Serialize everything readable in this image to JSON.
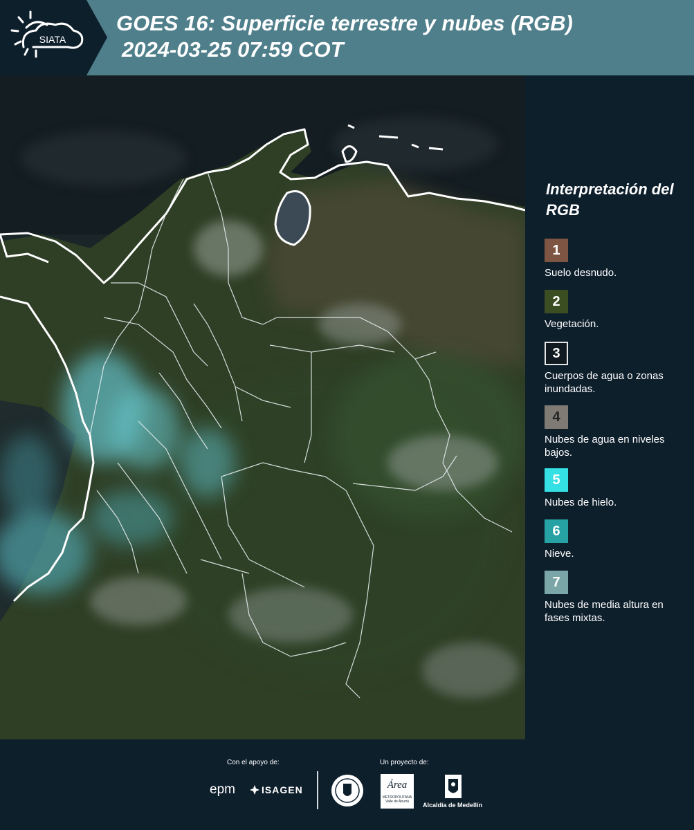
{
  "header": {
    "logo_text": "SIATA",
    "title_line1": "GOES 16: Superficie terrestre y nubes (RGB)",
    "title_line2": "2024-03-25 07:59 COT"
  },
  "legend": {
    "title": "Interpretación del RGB",
    "items": [
      {
        "number": "1",
        "label": "Suelo desnudo.",
        "color": "#7e5442"
      },
      {
        "number": "2",
        "label": "Vegetación.",
        "color": "#3a4e22"
      },
      {
        "number": "3",
        "label": "Cuerpos de agua o zonas inundadas.",
        "color": "#101a20"
      },
      {
        "number": "4",
        "label": "Nubes de agua en niveles bajos.",
        "color": "#7f7a73"
      },
      {
        "number": "5",
        "label": "Nubes de hielo.",
        "color": "#34e0e3"
      },
      {
        "number": "6",
        "label": "Nieve.",
        "color": "#26a2a5"
      },
      {
        "number": "7",
        "label": "Nubes de media altura en fases mixtas.",
        "color": "#7ba6a8"
      }
    ]
  },
  "footer": {
    "support_label": "Con el apoyo de:",
    "project_label": "Un proyecto de:",
    "sponsor_epm": "epm",
    "sponsor_isagen": "ISAGEN",
    "sponsor_area": "Área",
    "sponsor_area_sub": "METROPOLITANA Valle de Aburrá",
    "sponsor_medellin": "Alcaldía de Medellín"
  },
  "colors": {
    "background": "#0e1f2c",
    "header_bar": "#4f7f8b"
  }
}
